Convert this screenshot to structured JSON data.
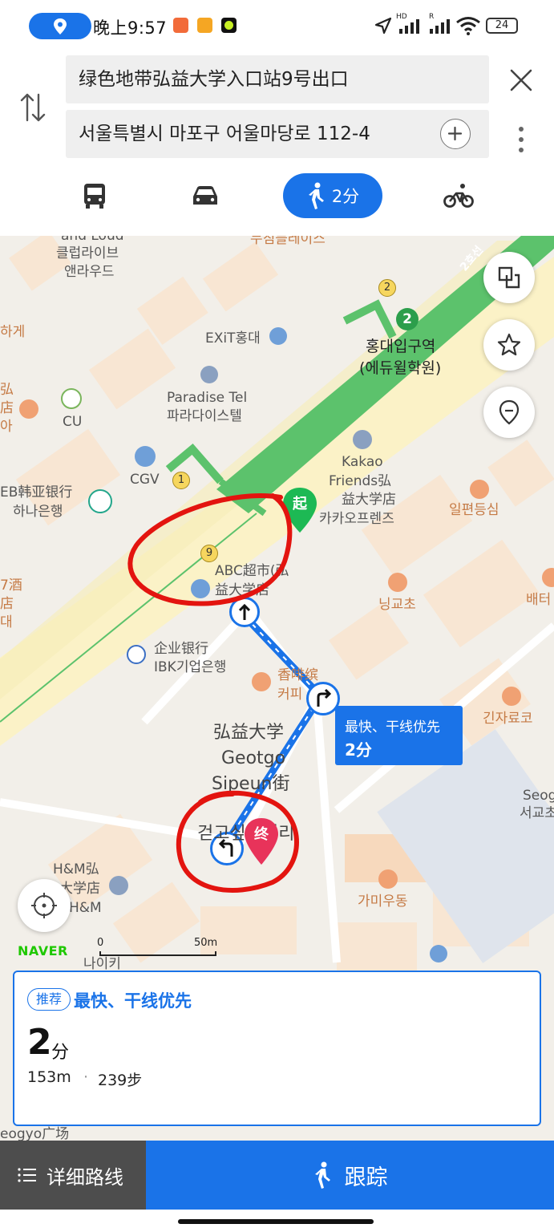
{
  "status_bar": {
    "time": "晚上9:57",
    "battery": "24",
    "network_labels": [
      "HD",
      "R"
    ]
  },
  "route": {
    "origin": "绿色地带弘益大学入口站9号出口",
    "destination": "서울특별시 마포구 어울마당로 112-4"
  },
  "modes": {
    "walk_time": "2分",
    "active": "walk",
    "items": [
      "bus-icon",
      "car-icon",
      "walk-icon",
      "bike-icon"
    ]
  },
  "map": {
    "labels": {
      "and_loud": "and Loud",
      "club_live": "클럽라이브",
      "andloud_kr": "앤라우드",
      "top_store": "누침플레이스",
      "exit_hongdae": "EXiT홍대",
      "paradise_en": "Paradise Tel",
      "paradise_kr": "파라다이스텔",
      "cu": "CU",
      "cgv": "CGV",
      "keb_cn": "EB韩亚银行",
      "keb_kr": "하나은행",
      "station_kr": "홍대입구역",
      "station_sub": "(에듀윌학원)",
      "kakao1": "Kakao",
      "kakao2": "Friends弘",
      "kakao3": "益大学店",
      "kakao4": "카카오프렌즈",
      "ilpyeon": "일편등심",
      "ningkyocho": "닝교초",
      "baeteo": "배터",
      "abc1": "ABC超市(弘",
      "abc2": "益大学店",
      "ibk_cn": "企业银行",
      "ibk_kr": "IBK기업은행",
      "cafe1": "香啡缤",
      "cafe2": "커피",
      "street1": "弘益大学",
      "street2": "Geotgo",
      "street3": "Sipeun街",
      "street4": "걷고싶은거리",
      "gija": "긴자료코",
      "seog_en": "Seog",
      "seog_kr": "서교초",
      "hm1": "H&M弘",
      "hm2": "大学店",
      "hm3": "H&M",
      "gamiudong": "가미우동",
      "nike": "나이키",
      "left_edge1": "하게",
      "left_edge2": "弘",
      "left_edge3": "店",
      "left_edge4": "아",
      "left_edge5": "7酒",
      "left_edge6": "店",
      "left_edge7": "대",
      "bottom_edge": "eogyo广场",
      "line2_badge": "2호선"
    },
    "exit_numbers": [
      "2",
      "1",
      "9"
    ],
    "line_number": "2",
    "start_marker": "起",
    "end_marker": "终",
    "callout": {
      "title": "最快、干线优先",
      "time": "2分"
    },
    "scale": {
      "zero": "0",
      "distance": "50m"
    },
    "naver": "NAVER"
  },
  "card": {
    "badge": "推荐",
    "title": "最快、干线优先",
    "time_value": "2",
    "time_unit": "分",
    "distance": "153m",
    "steps": "239步",
    "separator": "·"
  },
  "bottom": {
    "details": "详细路线",
    "track": "跟踪"
  },
  "colors": {
    "accent": "#1a73e8",
    "subway_green": "#5cc26c",
    "start_green": "#1db954",
    "end_red": "#e8335a",
    "annotation_red": "#e3140f"
  }
}
